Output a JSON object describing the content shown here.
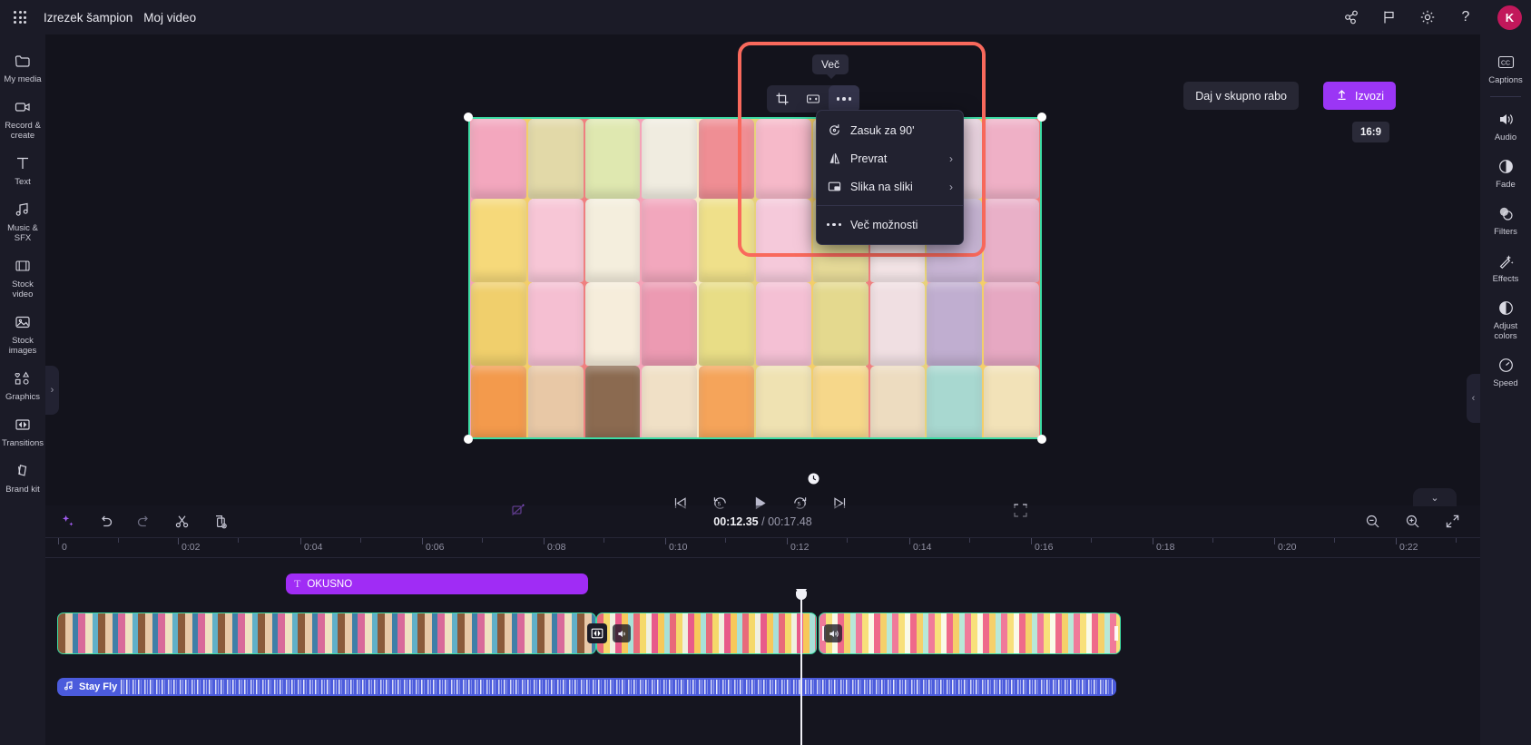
{
  "app": {
    "project_name": "Izrezek šampion",
    "project_subtitle": "Moj video"
  },
  "topbar": {
    "waffle_label": "app-launcher",
    "icons": [
      {
        "name": "share-network-icon",
        "glyph": "share"
      },
      {
        "name": "flag-icon",
        "glyph": "flag"
      },
      {
        "name": "gear-icon",
        "glyph": "gear"
      },
      {
        "name": "help-icon",
        "glyph": "?"
      }
    ],
    "avatar_initial": "K"
  },
  "sidebar": {
    "items": [
      {
        "label": "My media",
        "icon": "folder-icon"
      },
      {
        "label": "Record & create",
        "icon": "camera-icon"
      },
      {
        "label": "Text",
        "icon": "text-icon"
      },
      {
        "label": "Music & SFX",
        "icon": "music-icon"
      },
      {
        "label": "Stock video",
        "icon": "film-icon"
      },
      {
        "label": "Stock images",
        "icon": "image-icon"
      },
      {
        "label": "Graphics",
        "icon": "shapes-icon"
      },
      {
        "label": "Transitions",
        "icon": "transitions-icon"
      },
      {
        "label": "Brand kit",
        "icon": "brandkit-icon"
      }
    ],
    "expand_chevron": "›"
  },
  "right_sidebar": {
    "items": [
      {
        "label": "Captions",
        "icon": "captions-icon"
      },
      {
        "label": "Audio",
        "icon": "speaker-icon"
      },
      {
        "label": "Fade",
        "icon": "fade-icon"
      },
      {
        "label": "Filters",
        "icon": "filters-icon"
      },
      {
        "label": "Effects",
        "icon": "effects-icon"
      },
      {
        "label": "Adjust colors",
        "icon": "adjust-colors-icon"
      },
      {
        "label": "Speed",
        "icon": "speed-icon"
      }
    ],
    "collapse_chevron": "‹"
  },
  "actions": {
    "share_label": "Daj v skupno rabo",
    "export_label": "Izvozi",
    "aspect_ratio": "16:9"
  },
  "selection_toolbar": {
    "buttons": [
      {
        "name": "crop-button",
        "icon": "crop-icon"
      },
      {
        "name": "fit-button",
        "icon": "fit-icon"
      },
      {
        "name": "more-button",
        "icon": "more-dots-icon"
      }
    ],
    "tooltip": "Več"
  },
  "context_menu": {
    "items": [
      {
        "label": "Zasuk za 90'",
        "icon": "rotate-icon",
        "submenu": false
      },
      {
        "label": "Prevrat",
        "icon": "flip-icon",
        "submenu": true
      },
      {
        "label": "Slika na sliki",
        "icon": "pip-icon",
        "submenu": true
      }
    ],
    "footer_item": {
      "label": "Več možnosti",
      "icon": "more-dots-icon"
    },
    "chevron": "›",
    "highlight_color": "#f9695c"
  },
  "player": {
    "controls": [
      {
        "name": "skip-to-start-button",
        "icon": "skip-start-icon"
      },
      {
        "name": "rewind-5-button",
        "icon": "rewind-5-icon"
      },
      {
        "name": "play-button",
        "icon": "play-icon"
      },
      {
        "name": "forward-5-button",
        "icon": "forward-5-icon"
      },
      {
        "name": "skip-to-end-button",
        "icon": "skip-end-icon"
      }
    ],
    "reset_icon": "reset-icon",
    "magic_icon": "magic-wand-icon",
    "fullscreen_icon": "fullscreen-icon"
  },
  "timeline": {
    "toolbar": {
      "left_icons": [
        {
          "name": "ai-sparkle-button",
          "icon": "sparkle-icon"
        },
        {
          "name": "undo-button",
          "icon": "undo-icon"
        },
        {
          "name": "redo-button",
          "icon": "redo-icon"
        },
        {
          "name": "split-button",
          "icon": "scissors-icon"
        },
        {
          "name": "duplicate-button",
          "icon": "duplicate-icon"
        }
      ],
      "right_icons": [
        {
          "name": "zoom-out-button",
          "icon": "zoom-out-icon"
        },
        {
          "name": "zoom-in-button",
          "icon": "zoom-in-icon"
        },
        {
          "name": "fit-timeline-button",
          "icon": "fit-timeline-icon"
        }
      ]
    },
    "current_time": "00:12.35",
    "total_time": "00:17.48",
    "ruler_labels": [
      "0",
      "0:02",
      "0:04",
      "0:06",
      "0:08",
      "0:10",
      "0:12",
      "0:14",
      "0:16",
      "0:18",
      "0:20",
      "0:22"
    ],
    "collapse_chevron": "⌄",
    "clips": {
      "text_clip": {
        "label": "OKUSNO",
        "icon": "text-t-icon"
      },
      "audio_clip": {
        "label": "Stay Fly",
        "icon": "music-note-icon"
      },
      "video_badges": [
        {
          "name": "transition-badge",
          "icon": "transition-icon"
        },
        {
          "name": "mute-badge-1",
          "icon": "speaker-mute-icon"
        },
        {
          "name": "mute-badge-2",
          "icon": "speaker-icon"
        }
      ]
    }
  },
  "colors": {
    "accent": "#9b36f5",
    "text_clip": "#a02cf5",
    "audio_clip": "#4b5bdc",
    "selection": "#3ddca4",
    "highlight": "#f9695c",
    "avatar": "#c2185b"
  }
}
